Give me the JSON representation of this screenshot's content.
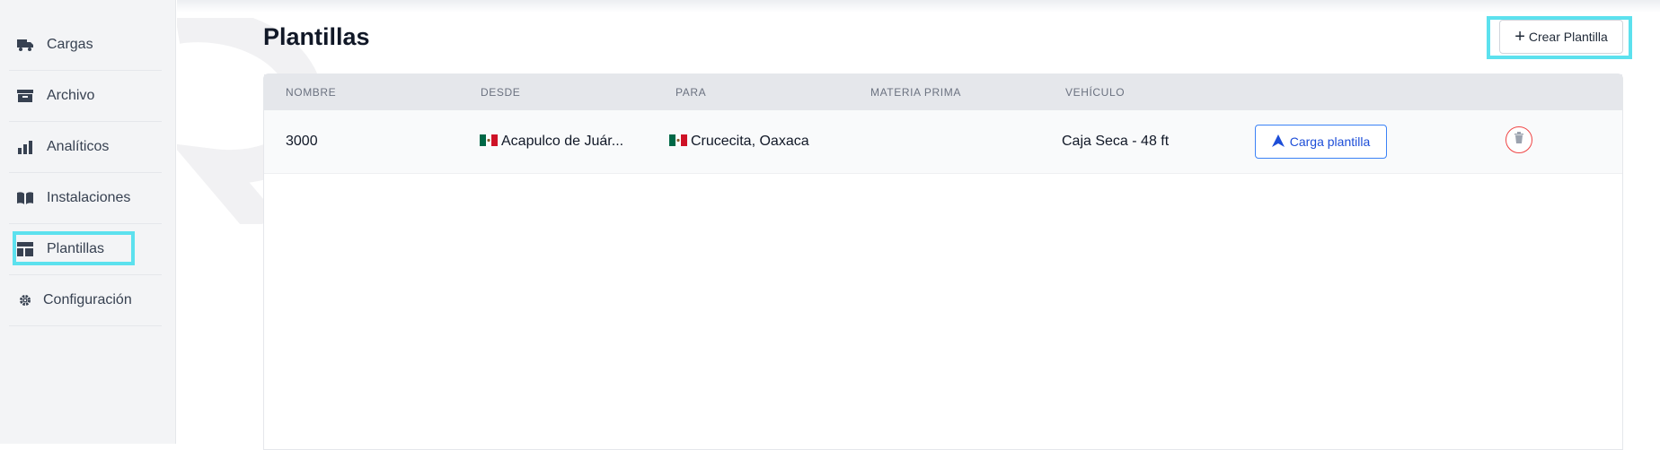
{
  "sidebar": {
    "items": [
      {
        "label": "Cargas",
        "icon": "truck-icon"
      },
      {
        "label": "Archivo",
        "icon": "archive-icon"
      },
      {
        "label": "Analíticos",
        "icon": "bar-chart-icon"
      },
      {
        "label": "Instalaciones",
        "icon": "book-icon"
      },
      {
        "label": "Plantillas",
        "icon": "template-icon",
        "active": true
      },
      {
        "label": "Configuración",
        "icon": "gear-icon"
      }
    ]
  },
  "header": {
    "title": "Plantillas",
    "create_label": "Crear Plantilla"
  },
  "table": {
    "columns": [
      "NOMBRE",
      "DESDE",
      "PARA",
      "MATERIA PRIMA",
      "VEHÍCULO"
    ],
    "rows": [
      {
        "nombre": "3000",
        "desde": "Acapulco de Juár...",
        "para": "Crucecita, Oaxaca",
        "materia_prima": "",
        "vehiculo": "Caja Seca - 48 ft",
        "action_label": "Carga plantilla"
      }
    ]
  },
  "colors": {
    "highlight": "#5ce1ee",
    "primary": "#1d4ed8",
    "danger": "#ef4444"
  }
}
